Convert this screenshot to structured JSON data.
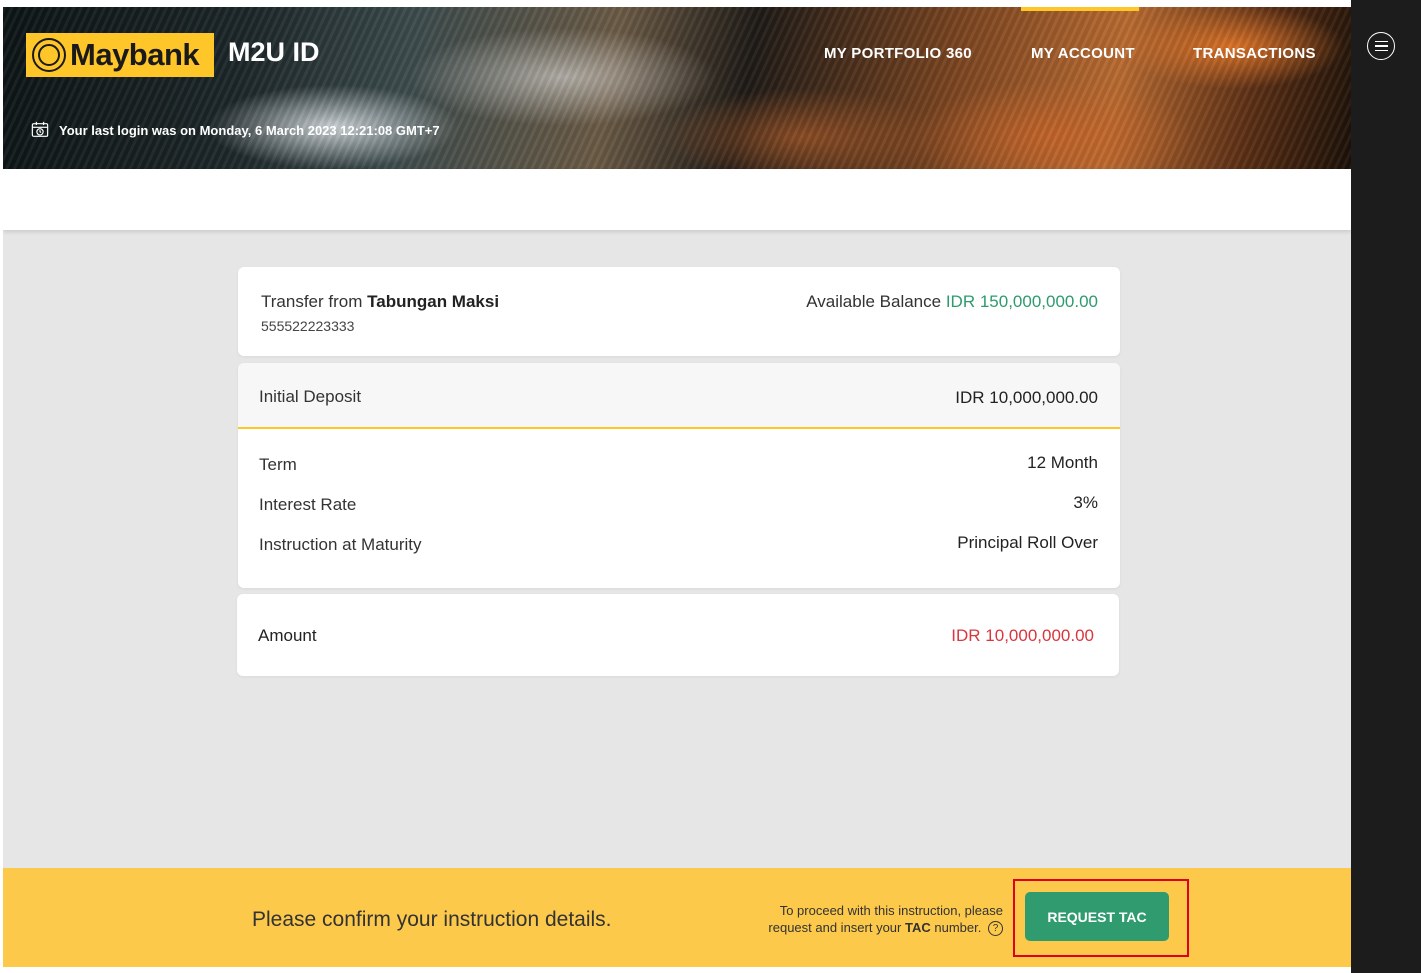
{
  "header": {
    "logo_text": "Maybank",
    "product": "M2U ID",
    "nav": [
      {
        "label": "MY PORTFOLIO 360",
        "active": false
      },
      {
        "label": "MY ACCOUNT",
        "active": true
      },
      {
        "label": "TRANSACTIONS",
        "active": false
      }
    ],
    "last_login": "Your last login was on Monday, 6 March 2023 12:21:08 GMT+7"
  },
  "transfer": {
    "from_prefix": "Transfer from",
    "account_name": "Tabungan Maksi",
    "account_number": "555522223333",
    "balance_label": "Available Balance",
    "balance_value": "IDR 150,000,000.00"
  },
  "deposit": {
    "initial_label": "Initial Deposit",
    "initial_value": "IDR 10,000,000.00",
    "term_label": "Term",
    "term_value": "12 Month",
    "rate_label": "Interest Rate",
    "rate_value": "3%",
    "maturity_label": "Instruction at Maturity",
    "maturity_value": "Principal Roll Over"
  },
  "amount": {
    "label": "Amount",
    "value": "IDR 10,000,000.00"
  },
  "footer": {
    "confirm": "Please confirm your instruction details.",
    "note_line1": "To proceed with this instruction, please",
    "note_line2_pre": "request and insert your",
    "note_tac": "TAC",
    "note_line2_post": "number.",
    "help_glyph": "?",
    "button": "REQUEST TAC"
  },
  "colors": {
    "brand_yellow": "#ffc629",
    "footer_yellow": "#fcc94b",
    "balance_green": "#2e9b6e",
    "amount_red": "#d9363e",
    "button_green": "#2f9b6f",
    "highlight_red": "#e0001b"
  },
  "icons": {
    "logo": "maybank-tiger-emblem-icon",
    "last_login": "calendar-clock-icon",
    "menu": "hamburger-menu-icon",
    "help": "question-circle-icon"
  }
}
